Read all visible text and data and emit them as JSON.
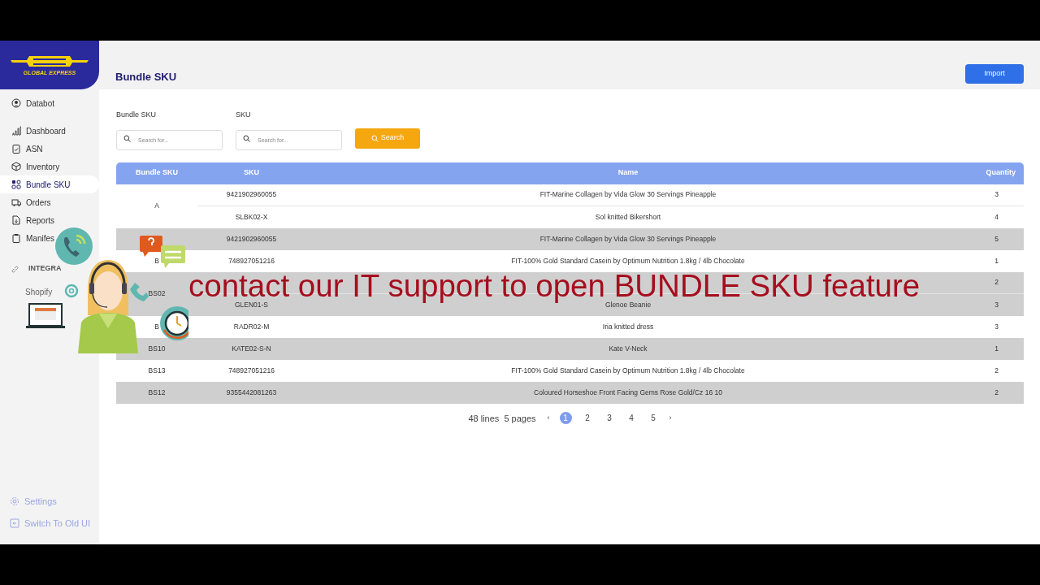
{
  "logo": {
    "tagline": "GLOBAL EXPRESS"
  },
  "sidebar": {
    "items": [
      {
        "label": "Databot",
        "selected": false
      },
      {
        "label": "Dashboard",
        "selected": false
      },
      {
        "label": "ASN",
        "selected": false
      },
      {
        "label": "Inventory",
        "selected": false
      },
      {
        "label": "Bundle SKU",
        "selected": true
      },
      {
        "label": "Orders",
        "selected": false
      },
      {
        "label": "Reports",
        "selected": false
      },
      {
        "label": "Manifes",
        "selected": false
      }
    ],
    "section": "INTEGRA",
    "integrations": [
      "Shopify"
    ],
    "footer": [
      "Settings",
      "Switch To Old UI"
    ]
  },
  "header": {
    "title": "Bundle SKU",
    "import_button": "Import"
  },
  "filters": [
    {
      "label": "Bundle SKU",
      "placeholder": "Search for..."
    },
    {
      "label": "SKU",
      "placeholder": "Search for..."
    }
  ],
  "search_button": "Search",
  "table": {
    "columns": [
      "Bundle SKU",
      "SKU",
      "Name",
      "Quantity"
    ],
    "groups": [
      {
        "bundle_sku": "A",
        "items": [
          {
            "sku": "9421902960055",
            "name": "FIT-Marine Collagen by Vida Glow 30 Servings Pineapple",
            "quantity": "3"
          },
          {
            "sku": "SLBK02-X",
            "name": "Sol knitted Bikershort",
            "quantity": "4"
          }
        ]
      },
      {
        "items": [
          {
            "sku": "9421902960055",
            "name": "FIT-Marine Collagen by Vida Glow 30 Servings Pineapple",
            "quantity": "5"
          }
        ]
      },
      {
        "bundle_sku": "B",
        "items": [
          {
            "sku": "748927051216",
            "name": "FIT-100% Gold Standard Casein by Optimum Nutrition 1.8kg / 4lb Chocolate",
            "quantity": "1"
          }
        ]
      },
      {
        "bundle_sku": "BS02",
        "items": [
          {
            "quantity": "2"
          },
          {
            "sku": "GLEN01-S",
            "name": "Glenoe Beanie",
            "quantity": "3"
          }
        ]
      },
      {
        "bundle_sku": "B",
        "items": [
          {
            "sku": "RADR02-M",
            "name": "Iria knitted dress",
            "quantity": "3"
          }
        ]
      },
      {
        "bundle_sku": "BS10",
        "items": [
          {
            "sku": "KATE02-S-N",
            "name": "Kate V-Neck",
            "quantity": "1"
          }
        ]
      },
      {
        "bundle_sku": "BS13",
        "items": [
          {
            "sku": "748927051216",
            "name": "FIT-100% Gold Standard Casein by Optimum Nutrition 1.8kg / 4lb Chocolate",
            "quantity": "2"
          }
        ]
      },
      {
        "bundle_sku": "BS12",
        "items": [
          {
            "sku": "9355442081263",
            "name": "Coloured Horseshoe Front Facing Gems Rose Gold/Cz 16 10",
            "quantity": "2"
          }
        ]
      }
    ]
  },
  "pagination": {
    "summary": "48 lines  5 pages",
    "prev": "‹",
    "next": "›",
    "pages": [
      {
        "label": "1",
        "selected": true
      },
      {
        "label": "2",
        "selected": false
      },
      {
        "label": "3",
        "selected": false
      },
      {
        "label": "4",
        "selected": false
      },
      {
        "label": "5",
        "selected": false
      }
    ]
  },
  "caption": "contact our IT support to open BUNDLE SKU feature"
}
